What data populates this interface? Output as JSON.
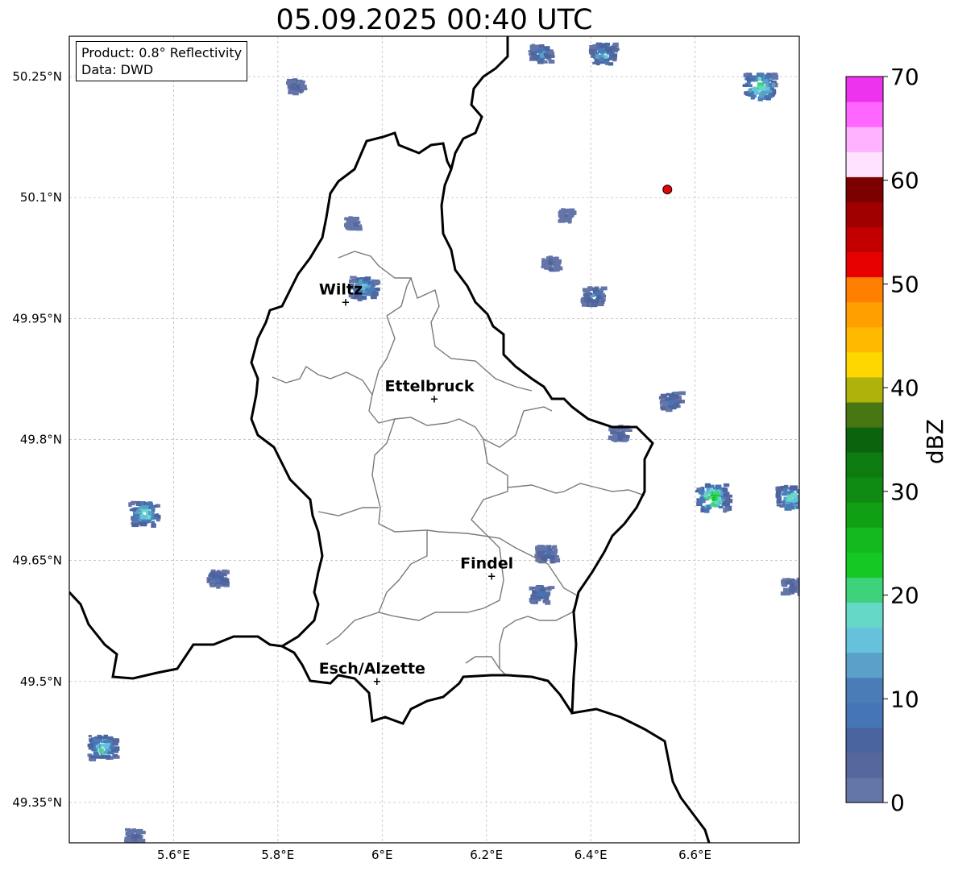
{
  "title": "05.09.2025 00:40 UTC",
  "info_box": {
    "product": "Product: 0.8° Reflectivity",
    "source": "Data: DWD"
  },
  "map": {
    "lon_range": [
      5.4,
      6.8
    ],
    "lat_range": [
      49.3,
      50.3
    ],
    "lat_ticks": [
      {
        "value": 50.25,
        "label": "50.25°N"
      },
      {
        "value": 50.1,
        "label": "50.1°N"
      },
      {
        "value": 49.95,
        "label": "49.95°N"
      },
      {
        "value": 49.8,
        "label": "49.8°N"
      },
      {
        "value": 49.65,
        "label": "49.65°N"
      },
      {
        "value": 49.5,
        "label": "49.5°N"
      },
      {
        "value": 49.35,
        "label": "49.35°N"
      }
    ],
    "lon_ticks": [
      {
        "value": 5.6,
        "label": "5.6°E"
      },
      {
        "value": 5.8,
        "label": "5.8°E"
      },
      {
        "value": 6.0,
        "label": "6°E"
      },
      {
        "value": 6.2,
        "label": "6.2°E"
      },
      {
        "value": 6.4,
        "label": "6.4°E"
      },
      {
        "value": 6.6,
        "label": "6.6°E"
      }
    ],
    "gridlines": true,
    "cities": [
      {
        "name": "Wiltz",
        "lon": 5.93,
        "lat": 49.97
      },
      {
        "name": "Ettelbruck",
        "lon": 6.1,
        "lat": 49.85
      },
      {
        "name": "Findel",
        "lon": 6.21,
        "lat": 49.63
      },
      {
        "name": "Esch/Alzette",
        "lon": 5.99,
        "lat": 49.5
      }
    ],
    "radar_site": {
      "lon": 6.547,
      "lat": 50.11,
      "color": "#e8000b"
    },
    "echoes": [
      {
        "lon": 6.3,
        "lat": 50.28,
        "max_dbz": 15
      },
      {
        "lon": 6.42,
        "lat": 50.28,
        "max_dbz": 20
      },
      {
        "lon": 6.72,
        "lat": 50.24,
        "max_dbz": 28
      },
      {
        "lon": 5.83,
        "lat": 50.24,
        "max_dbz": 8
      },
      {
        "lon": 6.35,
        "lat": 50.08,
        "max_dbz": 5
      },
      {
        "lon": 6.32,
        "lat": 50.02,
        "max_dbz": 8
      },
      {
        "lon": 6.4,
        "lat": 49.98,
        "max_dbz": 15
      },
      {
        "lon": 5.96,
        "lat": 49.99,
        "max_dbz": 22
      },
      {
        "lon": 5.94,
        "lat": 50.07,
        "max_dbz": 6
      },
      {
        "lon": 6.55,
        "lat": 49.85,
        "max_dbz": 14
      },
      {
        "lon": 6.45,
        "lat": 49.81,
        "max_dbz": 10
      },
      {
        "lon": 6.63,
        "lat": 49.73,
        "max_dbz": 30
      },
      {
        "lon": 6.78,
        "lat": 49.73,
        "max_dbz": 24
      },
      {
        "lon": 5.54,
        "lat": 49.71,
        "max_dbz": 25
      },
      {
        "lon": 5.68,
        "lat": 49.63,
        "max_dbz": 12
      },
      {
        "lon": 6.31,
        "lat": 49.66,
        "max_dbz": 12
      },
      {
        "lon": 6.3,
        "lat": 49.61,
        "max_dbz": 14
      },
      {
        "lon": 6.78,
        "lat": 49.62,
        "max_dbz": 10
      },
      {
        "lon": 5.46,
        "lat": 49.42,
        "max_dbz": 25
      },
      {
        "lon": 5.52,
        "lat": 49.31,
        "max_dbz": 8
      }
    ]
  },
  "colorbar": {
    "label": "dBZ",
    "min": 0,
    "max": 70,
    "step": 2.5,
    "tick_labels": [
      "0",
      "10",
      "20",
      "30",
      "40",
      "50",
      "60",
      "70"
    ],
    "colors": [
      "#6475a8",
      "#56679e",
      "#4a64a0",
      "#4575b4",
      "#4a7db8",
      "#5aa0c8",
      "#66c2dc",
      "#66d8c8",
      "#3ed37a",
      "#14c924",
      "#13b91d",
      "#119f14",
      "#0f8a12",
      "#0d7b10",
      "#0b640d",
      "#477713",
      "#aeb20a",
      "#ffd700",
      "#ffba00",
      "#ffa000",
      "#ff7f00",
      "#e60000",
      "#c30000",
      "#a00000",
      "#7d0000",
      "#ffe2ff",
      "#ffb2ff",
      "#ff66ff",
      "#ee33ee"
    ]
  }
}
